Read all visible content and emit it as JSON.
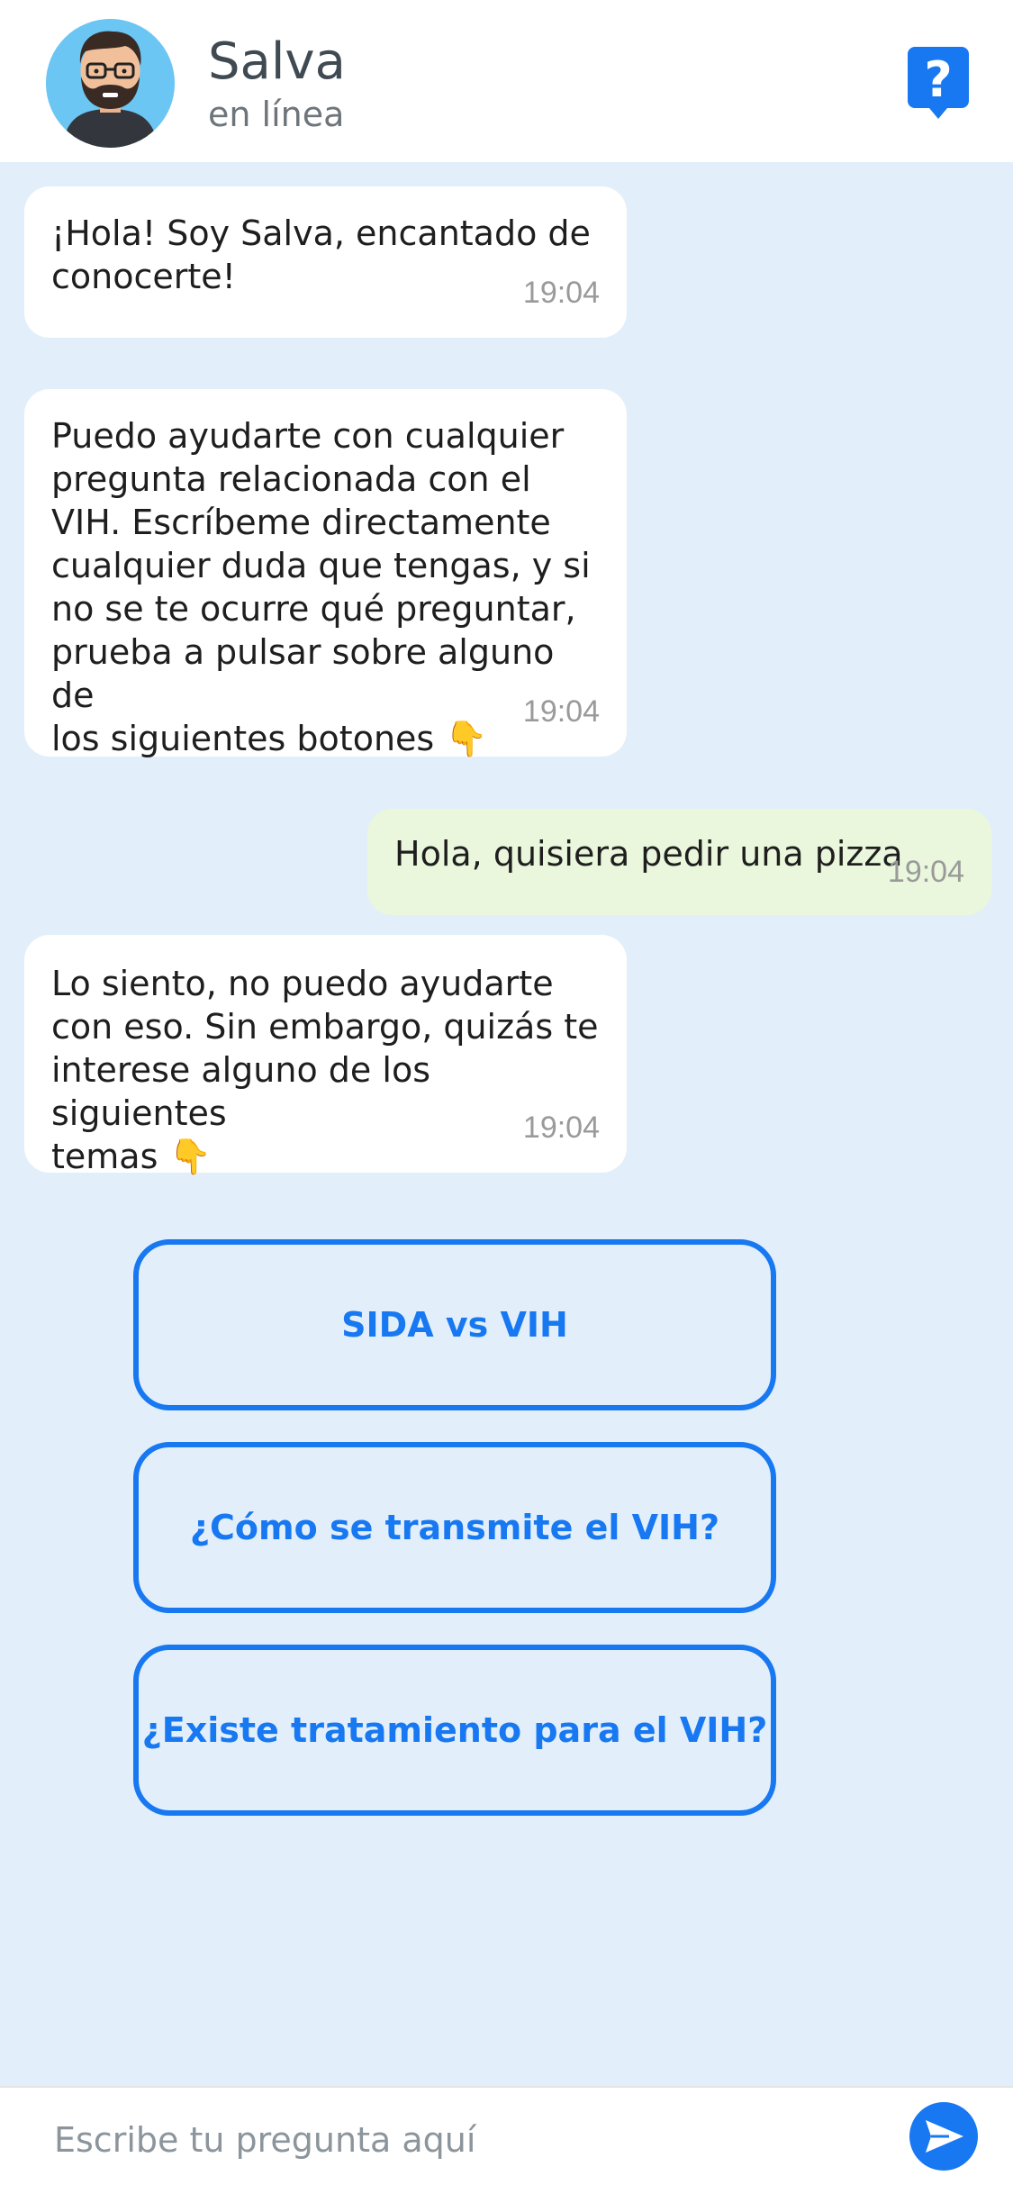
{
  "header": {
    "name": "Salva",
    "status": "en línea",
    "help_icon": "question-speech-bubble-icon",
    "accent": "#1778f2"
  },
  "messages": [
    {
      "direction": "in",
      "text": "¡Hola! Soy Salva, encantado de\nconocerte!",
      "time": "19:04"
    },
    {
      "direction": "in",
      "text": "Puedo ayudarte con cualquier\npregunta relacionada con el\nVIH. Escríbeme directamente\ncualquier duda que tengas, y si\nno se te ocurre qué preguntar,\nprueba a pulsar sobre alguno de\nlos siguientes botones 👇",
      "time": "19:04"
    },
    {
      "direction": "out",
      "text": "Hola, quisiera pedir una pizza",
      "time": "19:04"
    },
    {
      "direction": "in",
      "text": "Lo siento, no puedo ayudarte\ncon eso. Sin embargo, quizás te\ninterese alguno de los siguientes\ntemas 👇",
      "time": "19:04"
    }
  ],
  "suggestions": [
    "SIDA vs VIH",
    "¿Cómo se transmite el VIH?",
    "¿Existe tratamiento para el VIH?"
  ],
  "composer": {
    "placeholder": "Escribe tu pregunta aquí",
    "send_icon": "paper-plane-send-icon"
  },
  "colors": {
    "chat_background": "#e2effa",
    "incoming_bubble": "#ffffff",
    "outgoing_bubble": "#eaf7dc",
    "accent": "#1778f2"
  }
}
